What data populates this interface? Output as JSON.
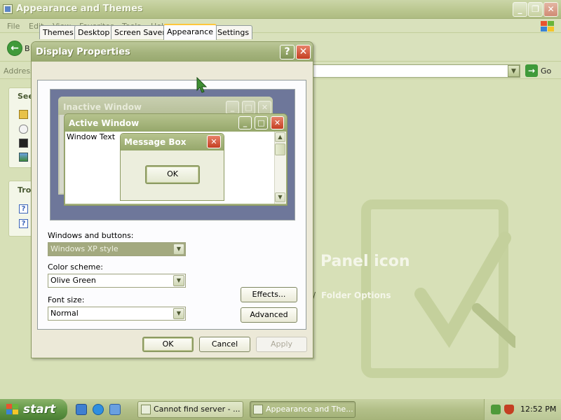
{
  "background_window": {
    "title": "Appearance and Themes",
    "menu": [
      "File",
      "Edit",
      "View",
      "Favorites",
      "Tools",
      "Help"
    ],
    "back_label": "B",
    "address_label": "Address",
    "go_label": "Go",
    "left_panel_heading_1": "See",
    "left_panel_heading_2": "Tro",
    "panel_icon_text": "Panel icon",
    "folder_options_label": "Folder Options"
  },
  "dialog": {
    "title": "Display Properties",
    "help_glyph": "?",
    "close_glyph": "✕",
    "tabs": [
      {
        "label": "Themes",
        "active": false
      },
      {
        "label": "Desktop",
        "active": false
      },
      {
        "label": "Screen Saver",
        "active": false
      },
      {
        "label": "Appearance",
        "active": true
      },
      {
        "label": "Settings",
        "active": false
      }
    ],
    "preview": {
      "inactive_window_title": "Inactive Window",
      "active_window_title": "Active Window",
      "window_text": "Window Text",
      "message_box_title": "Message Box",
      "ok_label": "OK"
    },
    "windows_and_buttons": {
      "label": "Windows and buttons:",
      "value": "Windows XP style",
      "disabled": true
    },
    "color_scheme": {
      "label": "Color scheme:",
      "value": "Olive Green"
    },
    "font_size": {
      "label": "Font size:",
      "value": "Normal"
    },
    "effects_button": "Effects...",
    "advanced_button": "Advanced",
    "ok_button": "OK",
    "cancel_button": "Cancel",
    "apply_button": "Apply",
    "apply_enabled": false
  },
  "taskbar": {
    "start_label": "start",
    "tasks": [
      {
        "label": "Cannot find server - ...",
        "active": false
      },
      {
        "label": "Appearance and The...",
        "active": true
      }
    ],
    "clock": "12:52 PM"
  },
  "icons": {
    "back": "back-arrow-icon",
    "go": "go-arrow-icon",
    "windows_logo": "windows-logo-icon",
    "cursor": "mouse-cursor-icon"
  },
  "colors": {
    "theme_olive": "#a4b37c",
    "close_red": "#c43f22",
    "tab_highlight": "#ffc73c",
    "start_green": "#5f9443"
  }
}
